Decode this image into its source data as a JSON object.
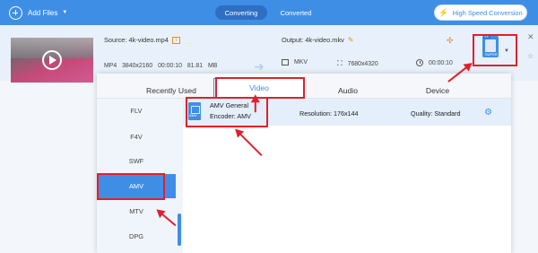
{
  "topbar": {
    "add_files": "Add Files",
    "tab_converting": "Converting",
    "tab_converted": "Converted",
    "high_speed": "High Speed Conversion"
  },
  "file": {
    "source_label": "Source: 4k-video.mp4",
    "source_meta": "MP4  3840x2160  00:00:10  81.81 MB",
    "output_label": "Output: 4k-video.mkv",
    "output_format": "MKV",
    "output_resolution": "7680x4320",
    "output_duration": "00:00:10",
    "format_button_badge": "4K",
    "format_button_label": "SUPER"
  },
  "panel": {
    "tabs": [
      "Recently Used",
      "Video",
      "Audio",
      "Device"
    ],
    "active_tab": "Video",
    "sidebar": [
      "FLV",
      "F4V",
      "SWF",
      "AMV",
      "MTV",
      "DPG"
    ],
    "active_sidebar": "AMV",
    "format_row": {
      "icon_label": "AMV",
      "name": "AMV General",
      "encoder": "Encoder: AMV",
      "resolution": "Resolution: 176x144",
      "quality": "Quality: Standard"
    }
  },
  "colors": {
    "accent": "#3f8ee6",
    "highlight": "#e0202c",
    "warning": "#e0902c"
  },
  "icons": [
    "plus-circle-icon",
    "bolt-icon",
    "info-icon",
    "pencil-icon",
    "move-icon",
    "film-icon",
    "resolution-icon",
    "clock-icon",
    "format-icon",
    "close-icon",
    "star-icon",
    "gear-icon"
  ]
}
